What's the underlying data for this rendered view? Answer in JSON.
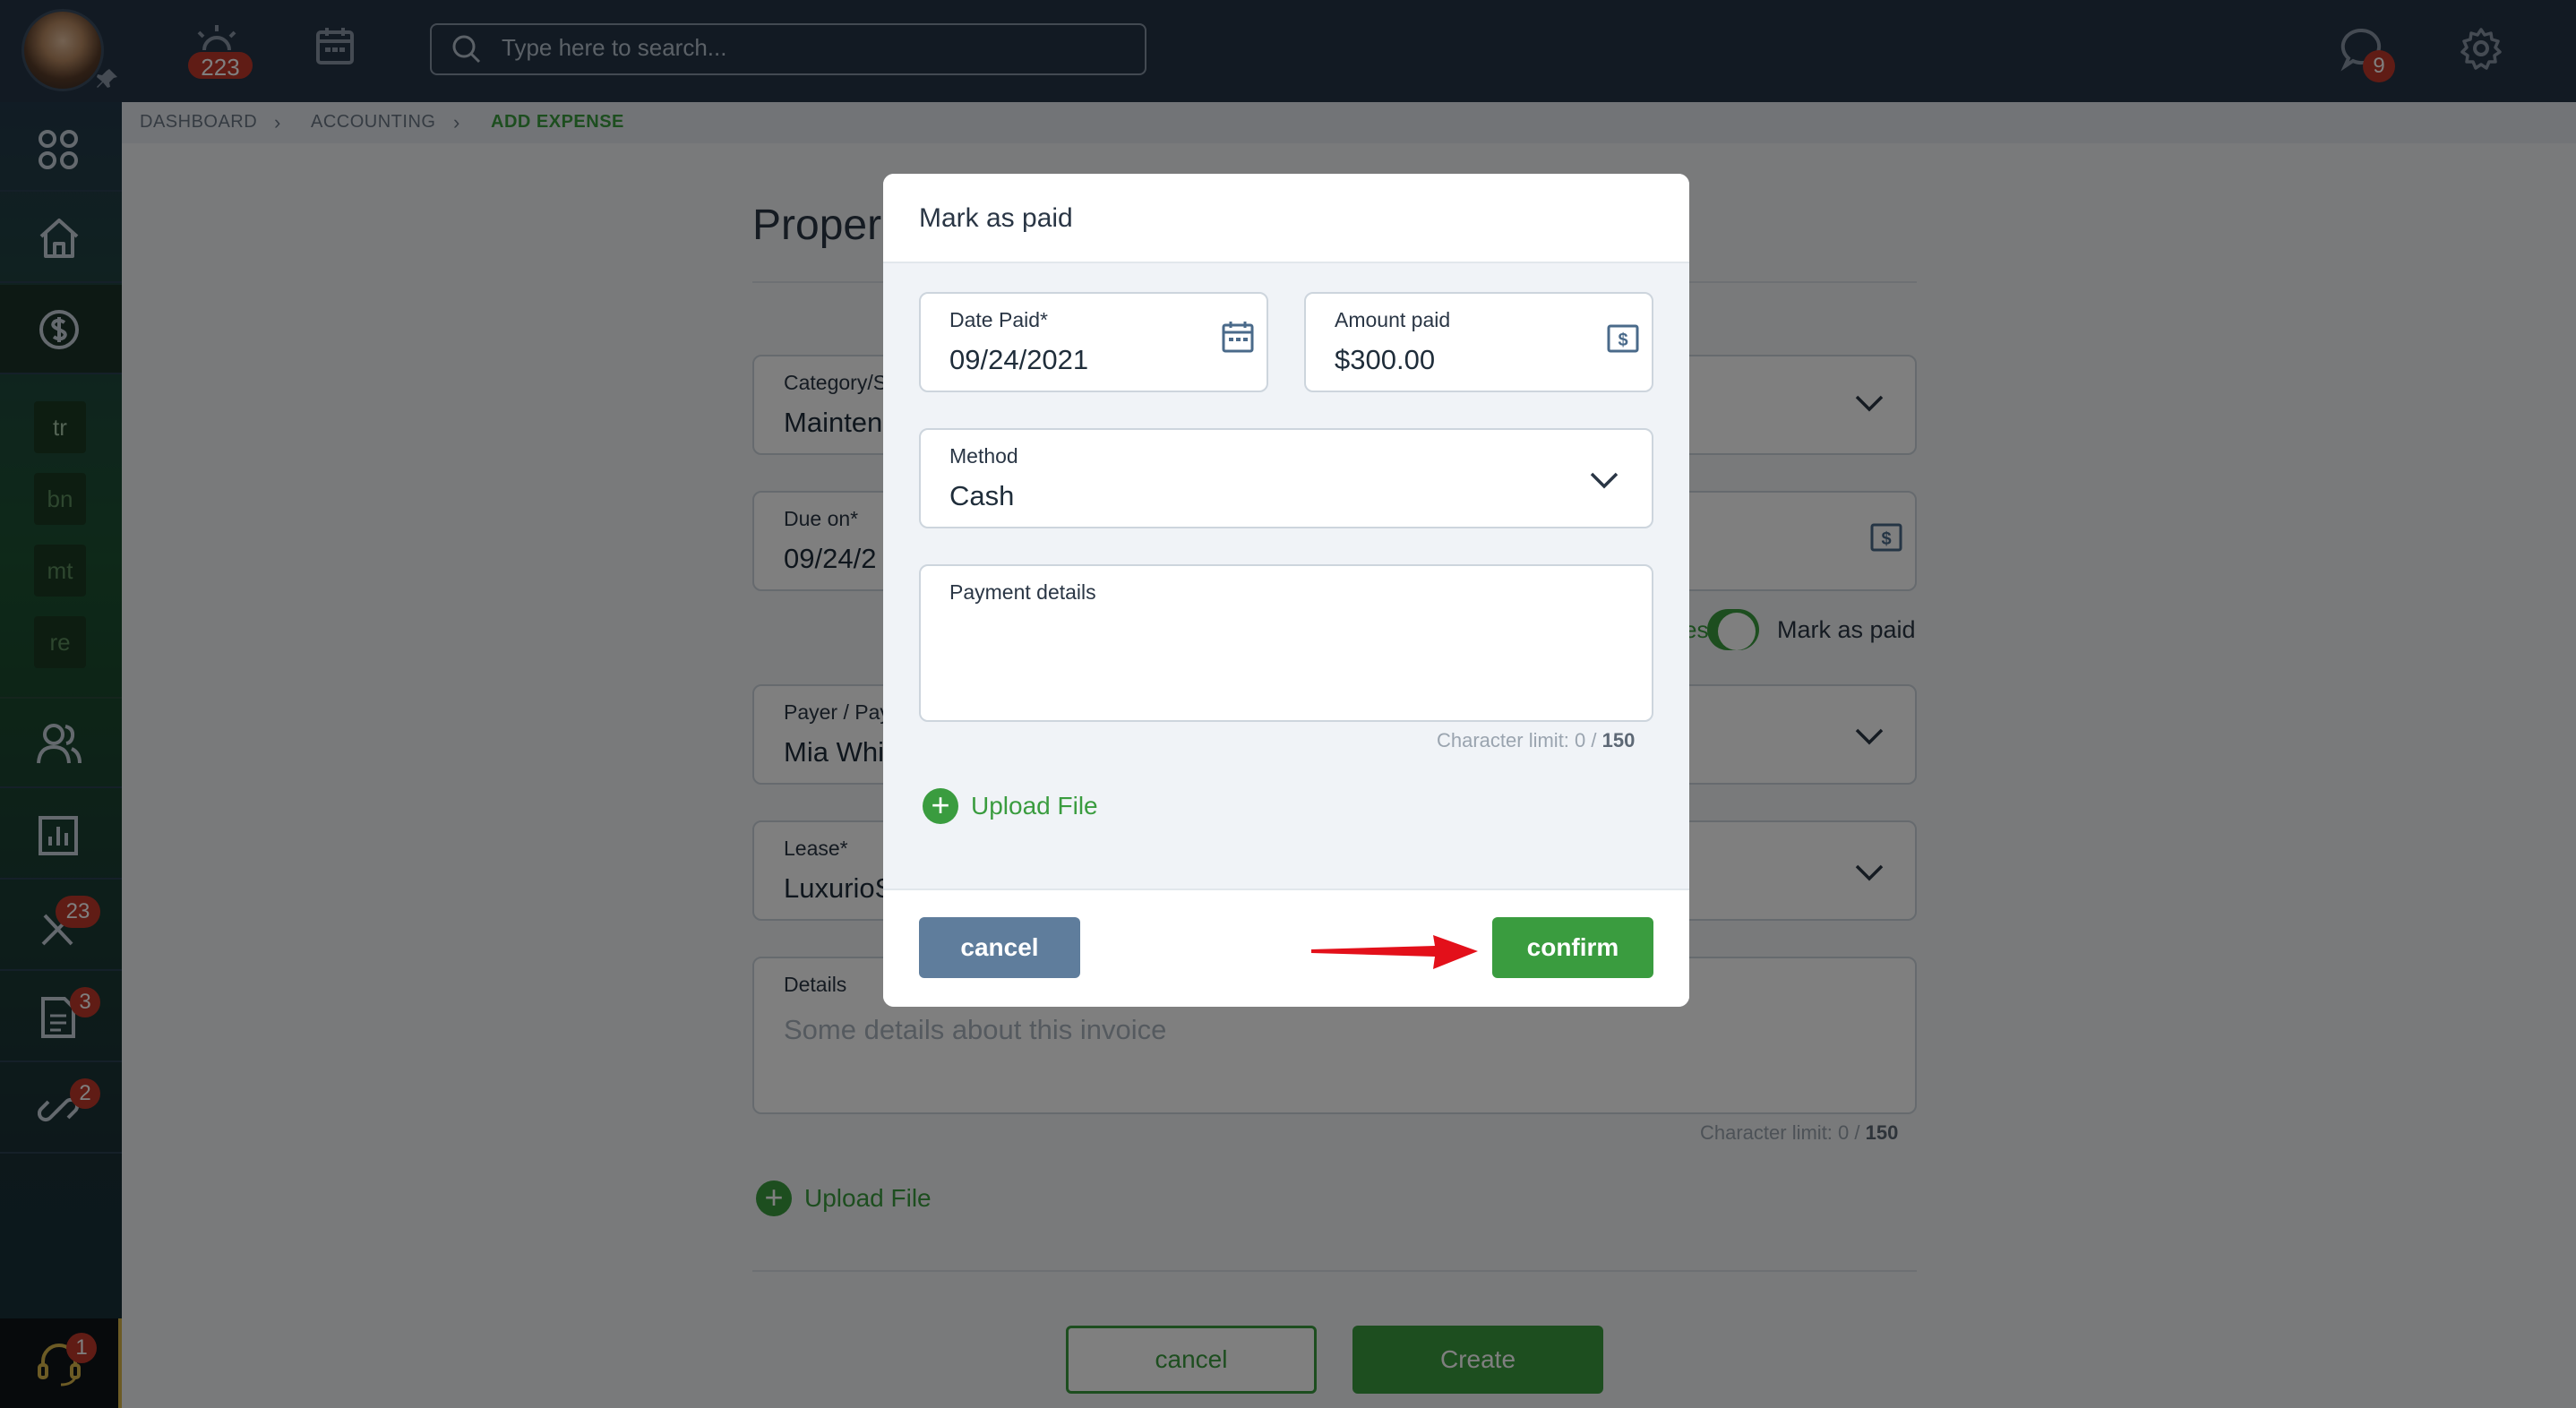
{
  "topbar": {
    "notifications_count": "223",
    "search_placeholder": "Type here to search...",
    "messages_count": "9"
  },
  "sidebar": {
    "boxes": [
      "tr",
      "bn",
      "mt",
      "re"
    ],
    "maintenance_badge": "23",
    "documents_badge": "3",
    "links_badge": "2",
    "support_badge": "1"
  },
  "breadcrumb": {
    "items": [
      "DASHBOARD",
      "ACCOUNTING",
      "ADD EXPENSE"
    ]
  },
  "form": {
    "title_partial": "Proper",
    "category_label": "Category/S",
    "category_value": "Mainten",
    "due_label": "Due on*",
    "due_value": "09/24/2",
    "toggle_partial": "es",
    "mark_as_paid_label": "Mark as paid",
    "payer_label": "Payer / Pay",
    "payer_value": "Mia Whi",
    "lease_label": "Lease*",
    "lease_value": "LuxurioS",
    "details_label": "Details",
    "details_placeholder": "Some details about this invoice",
    "char_limit_prefix": "Character limit: 0 / ",
    "char_limit_max": "150",
    "upload_label": "Upload File",
    "cancel_label": "cancel",
    "create_label": "Create"
  },
  "modal": {
    "title": "Mark as paid",
    "date_label": "Date Paid*",
    "date_value": "09/24/2021",
    "amount_label": "Amount paid",
    "amount_value": "$300.00",
    "method_label": "Method",
    "method_value": "Cash",
    "payment_details_label": "Payment details",
    "char_limit_prefix": "Character limit: 0 / ",
    "char_limit_max": "150",
    "upload_label": "Upload File",
    "cancel_label": "cancel",
    "confirm_label": "confirm"
  },
  "colors": {
    "topbar": "#243447",
    "accent_green": "#3a9c3f",
    "badge_red": "#c0392b",
    "cancel_blue": "#5f7d9c",
    "arrow_red": "#e3101a"
  }
}
